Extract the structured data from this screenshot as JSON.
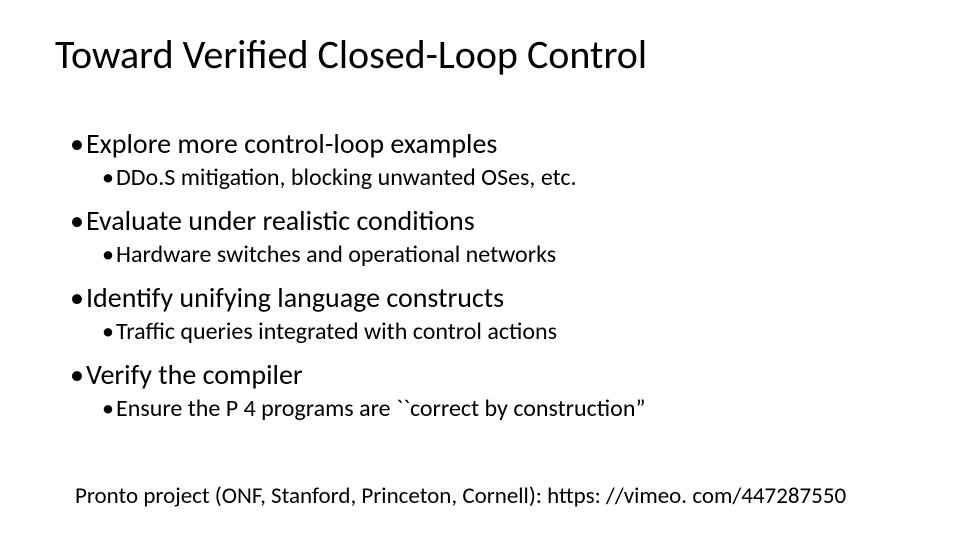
{
  "title": "Toward Verified Closed-Loop Control",
  "bullets": [
    {
      "l1": "Explore more control-loop examples",
      "l2": "DDo.S mitigation, blocking unwanted OSes, etc."
    },
    {
      "l1": "Evaluate under realistic conditions",
      "l2": "Hardware switches and operational networks"
    },
    {
      "l1": "Identify unifying language constructs",
      "l2": "Traffic queries integrated with control actions"
    },
    {
      "l1": "Verify the compiler",
      "l2": "Ensure the P 4 programs are ``correct by construction”"
    }
  ],
  "footer": "Pronto project (ONF, Stanford, Princeton, Cornell): https: //vimeo. com/447287550"
}
